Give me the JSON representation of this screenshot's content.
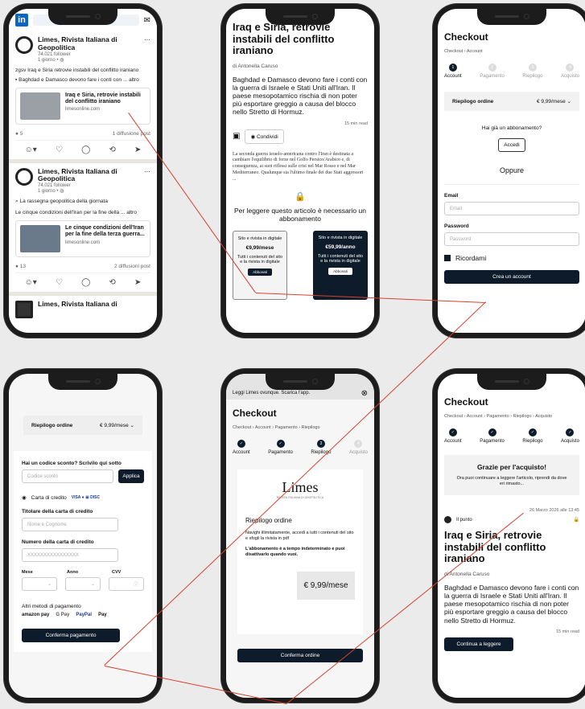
{
  "phone1": {
    "posts": [
      {
        "name": "Limes, Rivista Italiana di Geopolitica",
        "followers": "74.021 follower",
        "time": "1 giorno •",
        "card_title": "Iraq e Siria, retrovie instabili del conflitto iraniano",
        "card_source": "limesonline.com",
        "stats_left": "5",
        "stats_right": "1 diffusione post"
      },
      {
        "name": "Limes, Rivista Italiana di Geopolitica",
        "followers": "74.021 follower",
        "time": "1 giorno •",
        "card_title": "Le cinque condizioni dell'Iran per la fine della terza guerra...",
        "card_source": "limesonline.com",
        "stats_left": "13",
        "stats_right": "2 diffusioni post"
      }
    ],
    "post1_text": "zgsv Iraq e Siria retrovie instabili del conflitto iraniano",
    "post1_text2": "Baghdad e Damasco devono fare i conti con ... altro",
    "post2_text": "La rassegna geopolitica della giornata",
    "post2_text2": "Le cinque condizioni dell'Iran per la fine della ... altro",
    "post3_name": "Limes, Rivista Italiana di"
  },
  "phone2": {
    "title": "Iraq e Siria, retrovie instabili del conflitto iraniano",
    "author": "di Antonella Caruso",
    "lead": "Baghdad e Damasco devono fare i conti con la guerra di Israele e Stati Uniti all'Iran. Il paese mesopotamico rischia di non poter più esportare greggio a causa del blocco nello Stretto di Hormuz.",
    "readtime": "15 min read",
    "share": "Condividi",
    "body": "La seconda guerra israelo-americana contro l'Iran è destinata a cambiare l'equilibrio di forze nel Golfo Persico/Arabico e, di conseguenza, ai suoi riflessi sulle crisi nel Mar Rosso e nel Mar Mediterraneo. Qualunque sia l'ultimo finale dei due Stati aggressori ...",
    "paywall": "Per leggere questo articolo è necessario un abbonamento",
    "plans": [
      {
        "name": "Sito e rivista in digitale",
        "price": "€9,99/mese",
        "desc": "Tutti i contenuti del sito e la rivista in digitale",
        "btn": "Abbonati"
      },
      {
        "name": "Sito e rivista in digitale",
        "price": "€59,99/anno",
        "desc": "Tutti i contenuti del sito e la rivista in digitale",
        "btn": "Abbonati"
      }
    ]
  },
  "phone3": {
    "title": "Checkout",
    "crumb": "Checkout › Account",
    "steps": [
      "Account",
      "Pagamento",
      "Riepilogo",
      "Acquisto"
    ],
    "summary": "Riepilogo ordine",
    "price": "€ 9,99/mese",
    "have_sub": "Hai già un abbonamento?",
    "login": "Accedi",
    "or": "Oppure",
    "email_label": "Email",
    "email_ph": "Email",
    "pw_label": "Password",
    "pw_ph": "Password",
    "remember": "Ricordami",
    "create": "Crea un account"
  },
  "phone4": {
    "summary": "Riepilogo ordine",
    "price": "€ 9,99/mese",
    "discount_q": "Hai un codice sconto? Scrivilo qui sotto",
    "discount_ph": "Codice sconto",
    "apply": "Applica",
    "card": "Carta di credito",
    "holder_label": "Titolare della carta di credito",
    "holder_ph": "Nome e Cognome",
    "number_label": "Numero della carta di credito",
    "number_ph": "XXXXXXXXXXXXXXXX",
    "month": "Mese",
    "year": "Anno",
    "cvv": "CVV",
    "other": "Altri metodi di pagamento",
    "methods": [
      "amazon pay",
      "G Pay",
      "PayPal",
      "Pay"
    ],
    "confirm": "Conferma pagamento"
  },
  "phone5": {
    "banner": "Leggi Limes ovunque. Scarica l'app.",
    "title": "Checkout",
    "crumb": "Checkout › Account › Pagamento › Riepilogo",
    "steps": [
      "Account",
      "Pagamento",
      "Riepilogo",
      "Acquisto"
    ],
    "logo": "Limes",
    "logo_sub": "RIVISTA ITALIANA DI GEOPOLITICA",
    "summary_title": "Riepilogo ordine",
    "summary_text": "Navighi illimitatamente, accedi a tutti i contenuti del sito e sfogli la rivista in pdf",
    "summary_bold": "L'abbonamento è a tempo indeterminato e puoi disattivarlo quando vuoi.",
    "price": "€ 9,99/mese",
    "confirm": "Conferma ordine"
  },
  "phone6": {
    "title": "Checkout",
    "crumb": "Checkout › Account › Pagamento › Riepilogo › Acquisto",
    "steps": [
      "Account",
      "Pagamento",
      "Riepilogo",
      "Acquisto"
    ],
    "thanks": "Grazie per l'acquisto!",
    "thanks_text": "Ora puoi continuare a leggere l'articolo, riprendi da dove eri rimasto...",
    "date": "26 Marzo 2026 alle 13:45",
    "tag": "Il punto",
    "art_title": "Iraq e Siria, retrovie instabili del conflitto iraniano",
    "author": "di Antonella Caruso",
    "lead": "Baghdad e Damasco devono fare i conti con la guerra di Israele e Stati Uniti all'Iran. Il paese mesopotamico rischia di non poter più esportare greggio a causa del blocco nello Stretto di Hormuz.",
    "readtime": "15 min read",
    "continue": "Continua a leggere"
  }
}
